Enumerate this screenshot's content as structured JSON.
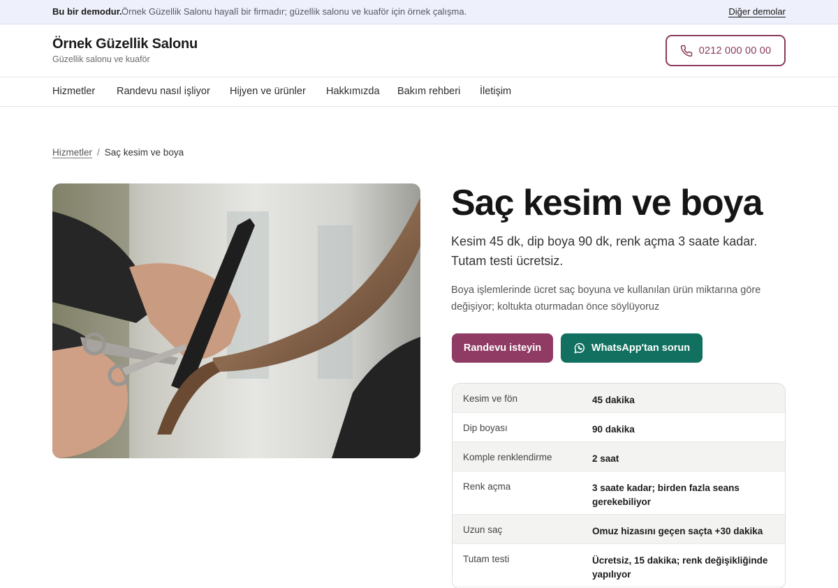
{
  "demo_bar": {
    "lead": "Bu bir demodur.",
    "message": "Örnek Güzellik Salonu hayalî bir firmadır; güzellik salonu ve kuaför için örnek çalışma.",
    "other_demos": "Diğer demolar"
  },
  "header": {
    "brand_name": "Örnek Güzellik Salonu",
    "brand_sub": "Güzellik salonu ve kuaför",
    "phone": "0212 000 00 00"
  },
  "nav": {
    "items": [
      "Hizmetler",
      "Randevu nasıl işliyor",
      "Hijyen ve ürünler",
      "Hakkımızda",
      "Bakım rehberi",
      "İletişim"
    ]
  },
  "breadcrumb": {
    "parent": "Hizmetler",
    "separator": "/",
    "current": "Saç kesim ve boya"
  },
  "service": {
    "title": "Saç kesim ve boya",
    "lead": "Kesim 45 dk, dip boya 90 dk, renk açma 3 saate kadar. Tutam testi ücretsiz.",
    "body": "Boya işlemlerinde ücret saç boyuna ve kullanılan ürün miktarına göre değişiyor; koltukta oturmadan önce söylüyoruz",
    "primary_button": "Randevu isteyin",
    "whatsapp_button": "WhatsApp'tan sorun"
  },
  "durations": [
    {
      "label": "Kesim ve fön",
      "value": "45 dakika"
    },
    {
      "label": "Dip boyası",
      "value": "90 dakika"
    },
    {
      "label": "Komple renklendirme",
      "value": "2 saat"
    },
    {
      "label": "Renk açma",
      "value": "3 saate kadar; birden fazla seans gerekebiliyor"
    },
    {
      "label": "Uzun saç",
      "value": "Omuz hizasını geçen saçta +30 dakika"
    },
    {
      "label": "Tutam testi",
      "value": "Ücretsiz, 15 dakika; renk değişikliğinde yapılıyor"
    }
  ],
  "colors": {
    "accent": "#8f3b63",
    "whatsapp": "#11705f",
    "demo_bar_bg": "#eef0fb"
  },
  "icons": {
    "phone": "phone-icon",
    "whatsapp": "whatsapp-icon"
  }
}
